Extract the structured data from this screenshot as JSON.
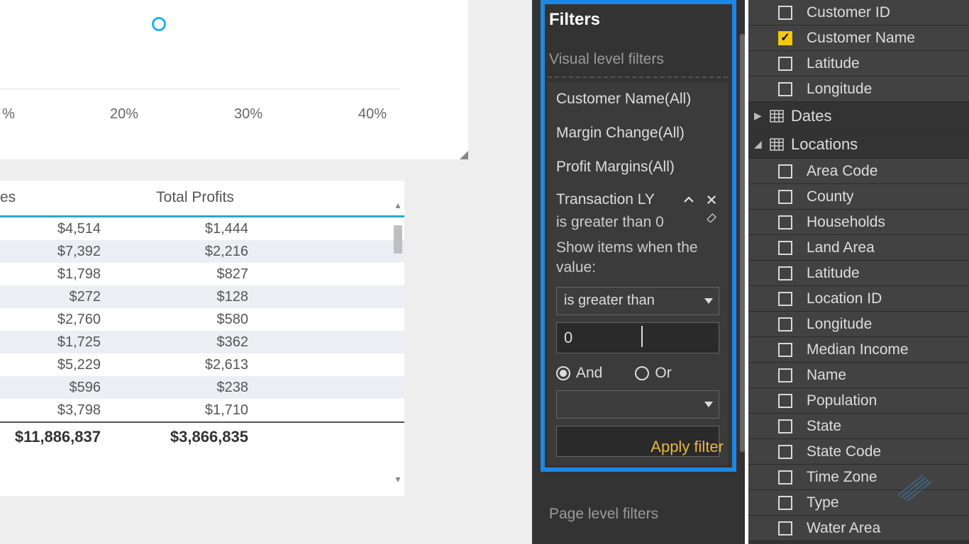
{
  "chart": {
    "ticks": [
      "%",
      "20%",
      "30%",
      "40%"
    ]
  },
  "table": {
    "headers": [
      "es",
      "Total Profits"
    ],
    "rows": [
      [
        "$4,514",
        "$1,444"
      ],
      [
        "$7,392",
        "$2,216"
      ],
      [
        "$1,798",
        "$827"
      ],
      [
        "$272",
        "$128"
      ],
      [
        "$2,760",
        "$580"
      ],
      [
        "$1,725",
        "$362"
      ],
      [
        "$5,229",
        "$2,613"
      ],
      [
        "$596",
        "$238"
      ],
      [
        "$3,798",
        "$1,710"
      ]
    ],
    "totals": [
      "$11,886,837",
      "$3,866,835"
    ]
  },
  "filters": {
    "title": "Filters",
    "visual_label": "Visual level filters",
    "page_label": "Page level filters",
    "cards": [
      "Customer Name(All)",
      "Margin Change(All)",
      "Profit Margins(All)"
    ],
    "advanced": {
      "name": "Transaction LY",
      "condition_text": "is greater than 0",
      "show_items_label": "Show items when the value:",
      "operator": "is greater than",
      "value": "0",
      "and_label": "And",
      "or_label": "Or",
      "logic_selected": "And",
      "operator2": "",
      "value2": ""
    },
    "apply_label": "Apply filter"
  },
  "fields": {
    "group_a": [
      {
        "label": "Customer ID",
        "checked": false
      },
      {
        "label": "Customer Name",
        "checked": true
      },
      {
        "label": "Latitude",
        "checked": false
      },
      {
        "label": "Longitude",
        "checked": false
      }
    ],
    "tables": [
      {
        "name": "Dates",
        "expanded": false
      },
      {
        "name": "Locations",
        "expanded": true
      }
    ],
    "locations_fields": [
      "Area Code",
      "County",
      "Households",
      "Land Area",
      "Latitude",
      "Location ID",
      "Longitude",
      "Median Income",
      "Name",
      "Population",
      "State",
      "State Code",
      "Time Zone",
      "Type",
      "Water Area"
    ]
  }
}
